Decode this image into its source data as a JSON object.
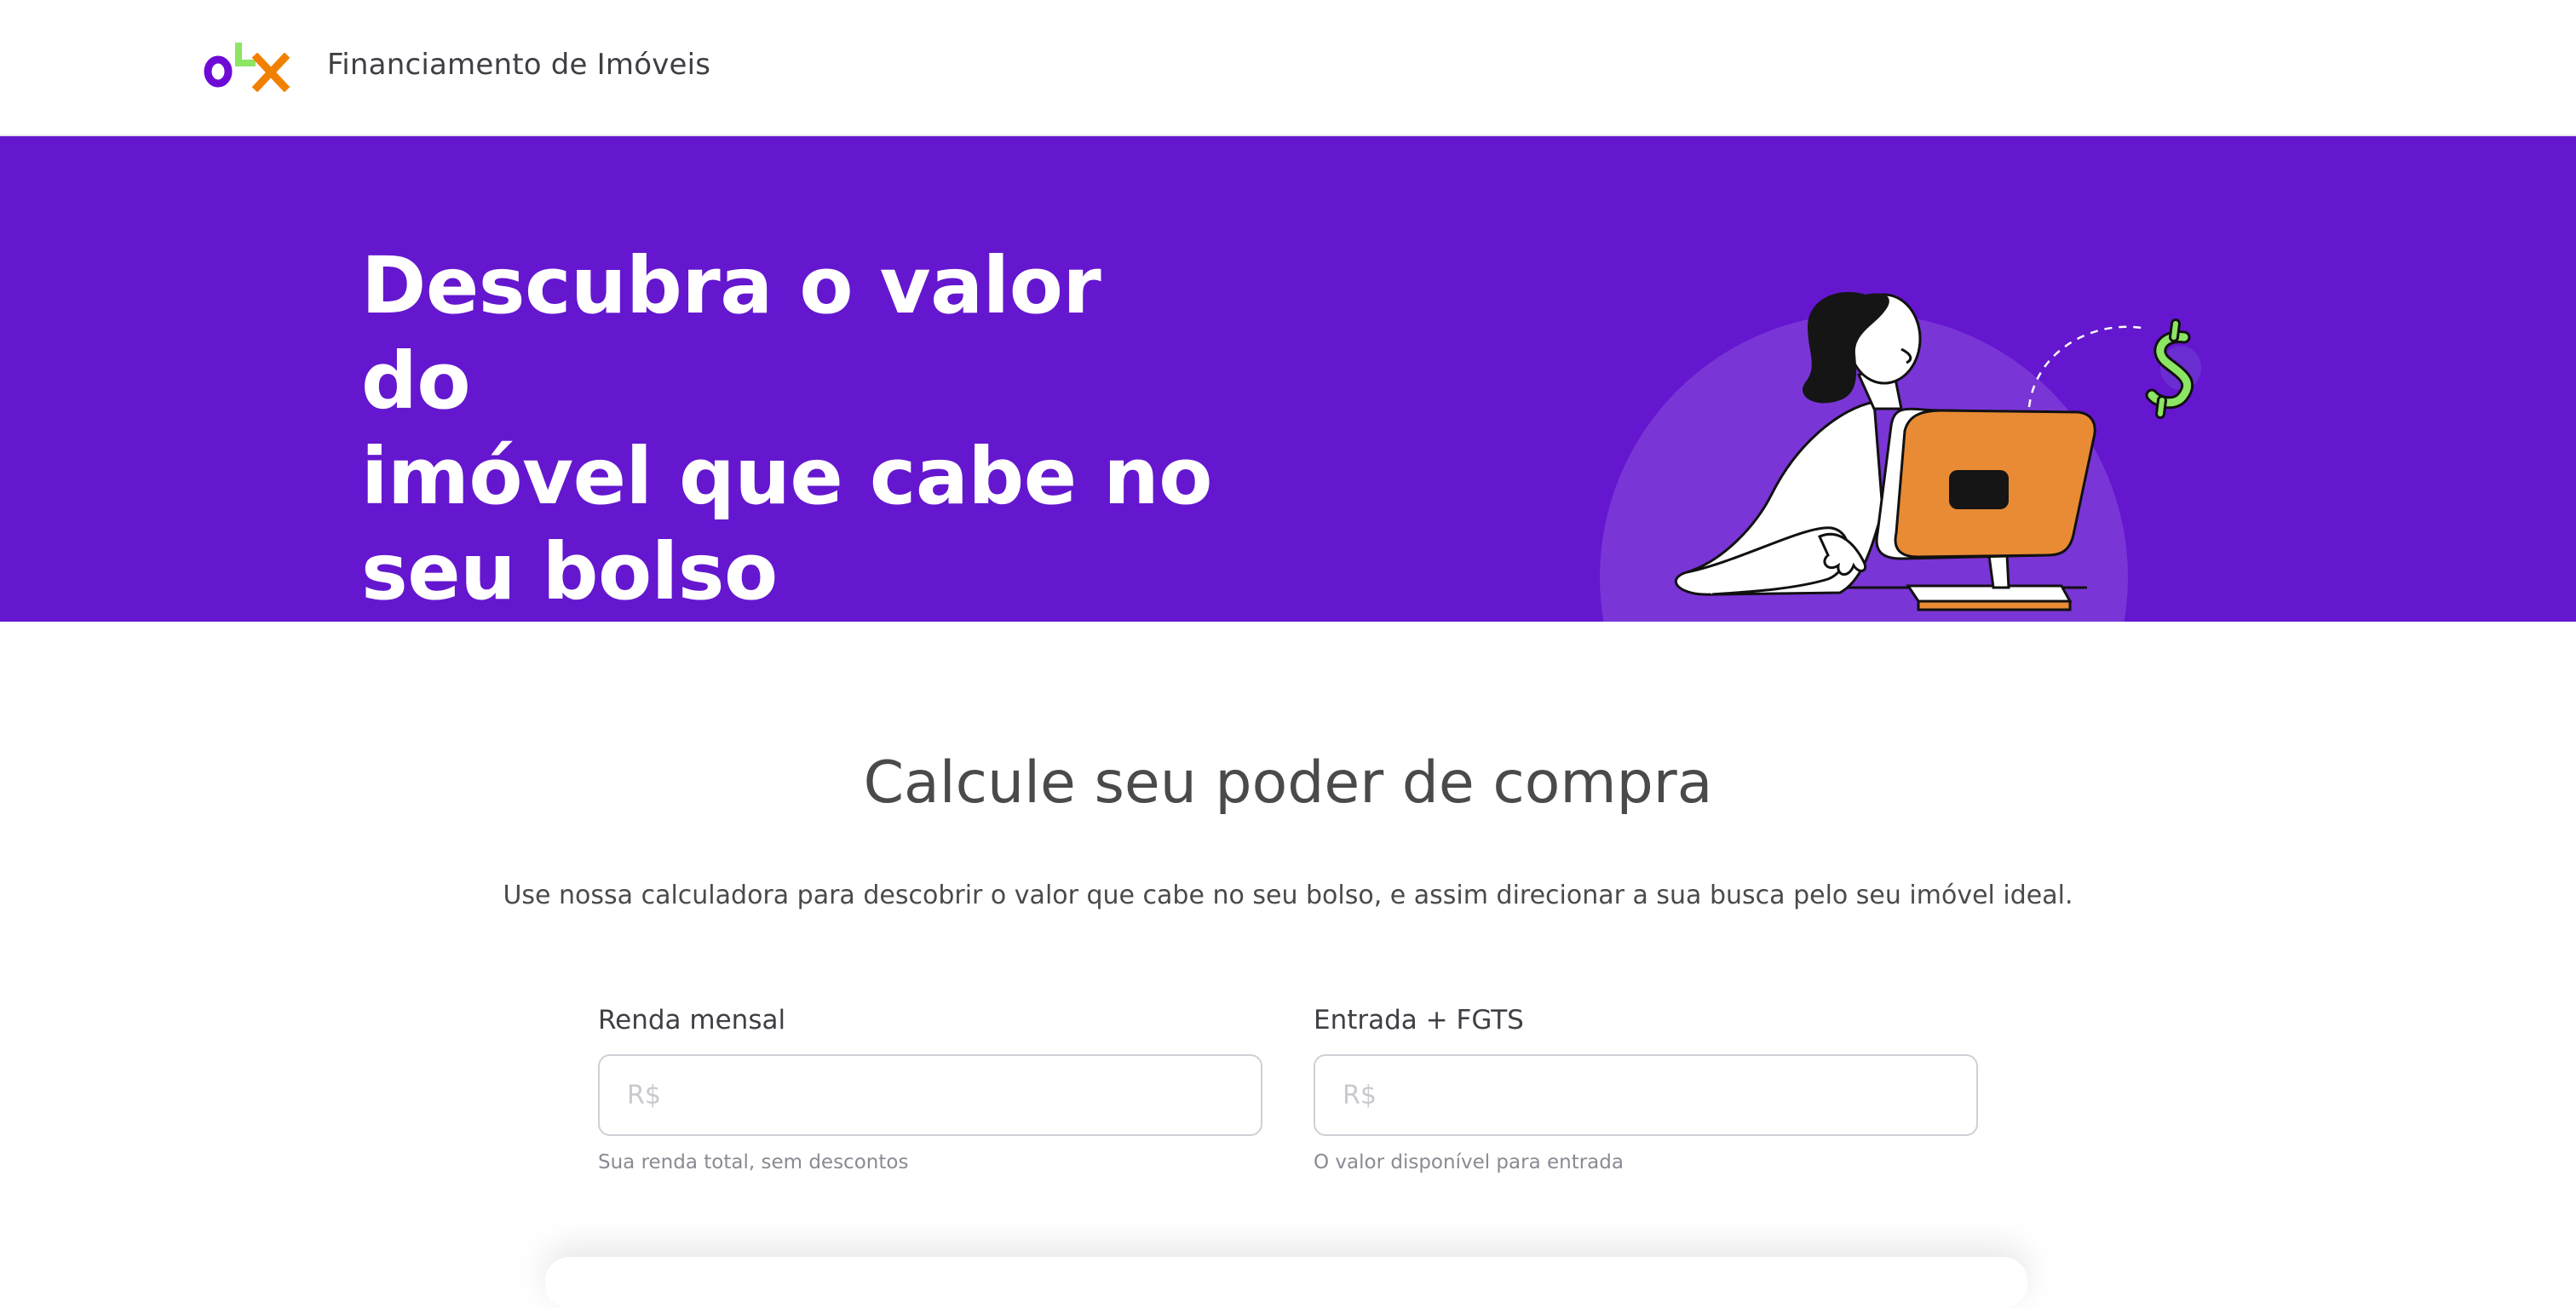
{
  "header": {
    "logo_text": "OLX",
    "title": "Financiamento de Imóveis"
  },
  "hero": {
    "title_lines": [
      "Descubra o valor do",
      "imóvel que cabe no",
      "seu bolso"
    ],
    "illustration": "woman-at-computer-illustration",
    "money_icon": "dollar-sign-icon"
  },
  "colors": {
    "brand_purple": "#6417cf",
    "logo_purple": "#6e0ad6",
    "logo_green": "#8ce563",
    "logo_orange": "#f28000",
    "monitor_orange": "#e88b34"
  },
  "main": {
    "title": "Calcule seu poder de compra",
    "description": "Use nossa calculadora para descobrir o valor que cabe no seu bolso, e assim direcionar a sua busca pelo seu imóvel ideal.",
    "fields": [
      {
        "label": "Renda mensal",
        "placeholder": "R$",
        "value": "",
        "help": "Sua renda total, sem descontos"
      },
      {
        "label": "Entrada + FGTS",
        "placeholder": "R$",
        "value": "",
        "help": "O valor disponível para entrada"
      }
    ]
  }
}
